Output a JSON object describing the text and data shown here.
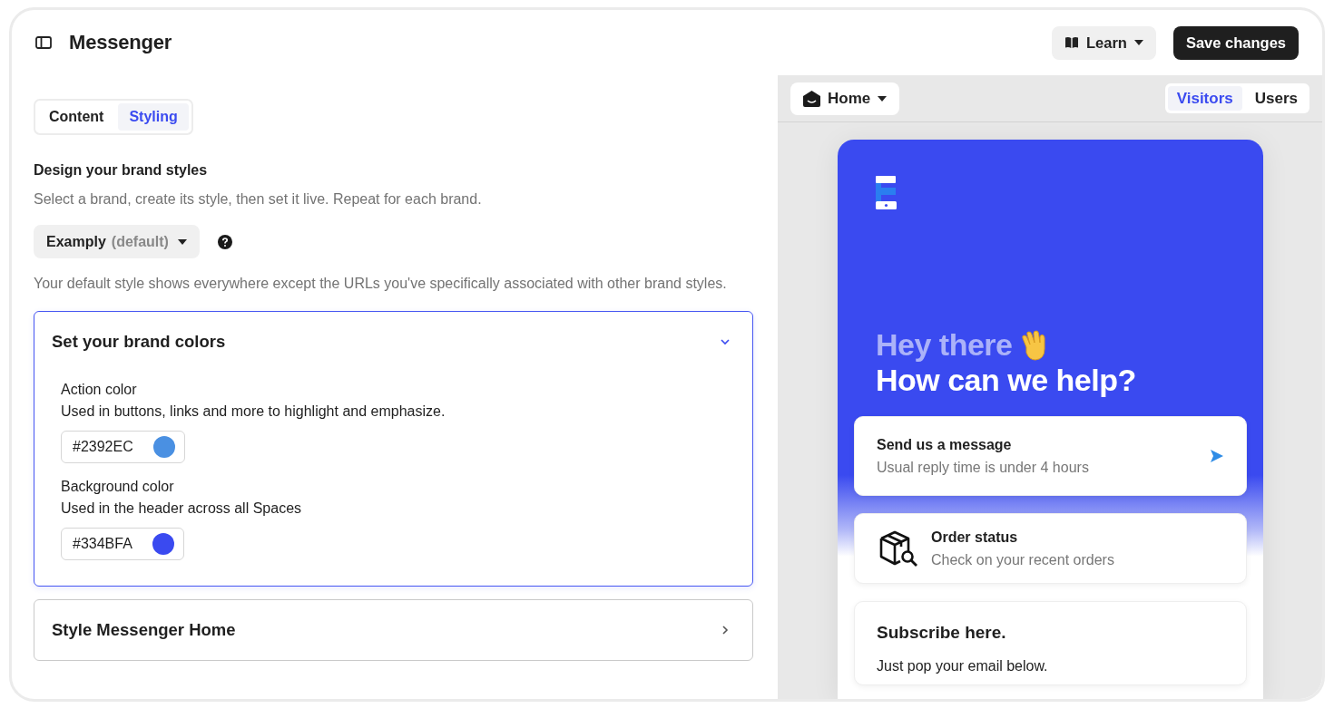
{
  "header": {
    "title": "Messenger",
    "learn_button": "Learn",
    "save_button": "Save changes"
  },
  "tabs": [
    {
      "label": "Content",
      "selected": false
    },
    {
      "label": "Styling",
      "selected": true
    }
  ],
  "intro": {
    "heading": "Design your brand styles",
    "description": "Select a brand, create its style, then set it live. Repeat for each brand.",
    "brand_select": {
      "name": "Examply",
      "suffix": "(default)"
    },
    "note": "Your default style shows everywhere except the URLs you've specifically associated with other brand styles."
  },
  "sections": [
    {
      "title": "Set your brand colors",
      "expanded": true,
      "fields": [
        {
          "label": "Action color",
          "description": "Used in buttons, links and more to highlight and emphasize.",
          "value": "#2392EC",
          "color": "#4a90e2"
        },
        {
          "label": "Background color",
          "description": "Used in the header across all Spaces",
          "value": "#334BFA",
          "color": "#3a4af0"
        }
      ]
    },
    {
      "title": "Style Messenger Home",
      "expanded": false
    }
  ],
  "preview": {
    "page_select": "Home",
    "audience_tabs": [
      {
        "label": "Visitors",
        "selected": true
      },
      {
        "label": "Users",
        "selected": false
      }
    ],
    "greeting": "Hey there",
    "headline": "How can we help?",
    "cards": [
      {
        "kind": "message",
        "title": "Send us a message",
        "subtitle": "Usual reply time is under 4 hours"
      },
      {
        "kind": "order",
        "title": "Order status",
        "subtitle": "Check on your recent orders"
      },
      {
        "kind": "subscribe",
        "title": "Subscribe here.",
        "subtitle": "Just pop your email below."
      }
    ]
  }
}
